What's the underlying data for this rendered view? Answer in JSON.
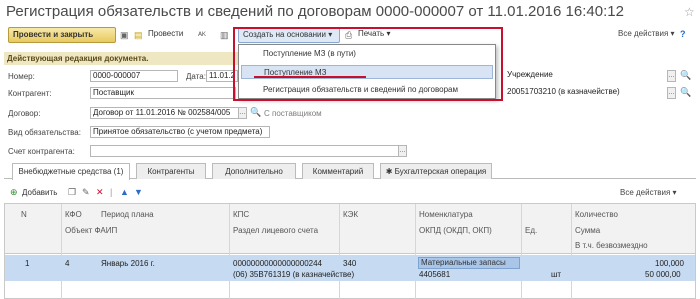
{
  "window": {
    "title": "Регистрация обязательств и сведений по договорам 0000-000007 от 11.01.2016 16:40:12"
  },
  "toolbar": {
    "post_close": "Провести и закрыть",
    "post": "Провести",
    "create_based": "Создать на основании",
    "print": "Печать",
    "all_actions": "Все действия"
  },
  "dropdown": {
    "items": [
      "Поступление МЗ (в пути)",
      "Поступление МЗ",
      "Регистрация обязательств и сведений по договорам"
    ]
  },
  "form": {
    "edit_note": "Действующая редакция документа.",
    "number_label": "Номер:",
    "number": "0000-000007",
    "date_label": "Дата:",
    "date": "11.01.2",
    "institution": "Учреждение",
    "contractor_label": "Контрагент:",
    "contractor": "Поставщик",
    "contractor_account": "20051703210 (в казначействе)",
    "contract_label": "Договор:",
    "contract": "Договор от 11.01.2016 № 002584/005",
    "contract_link": "С поставщиком",
    "obligation_type_label": "Вид обязательства:",
    "obligation_type": "Принятое обязательство (с учетом предмета)",
    "contractor_acc_label": "Счет контрагента:"
  },
  "tabs": [
    "Внебюджетные средства (1)",
    "Контрагенты",
    "Дополнительно",
    "Комментарий",
    "Бухгалтерская операция"
  ],
  "grid_toolbar": {
    "add": "Добавить",
    "all_actions": "Все действия"
  },
  "grid": {
    "headers": {
      "n": "N",
      "kfo": "КФО",
      "period": "Период плана",
      "kps": "КПС",
      "kek": "КЭК",
      "nomenclature": "Номенклатура",
      "quantity": "Количество",
      "object": "Объект ФАИП",
      "section": "Раздел лицевого счета",
      "okpd": "ОКПД (ОКДП, ОКП)",
      "unit": "Ед.",
      "sum": "Сумма",
      "free": "В т.ч. безвозмездно"
    },
    "rows": [
      {
        "n": "1",
        "kfo": "4",
        "period": "Январь 2016 г.",
        "kps": "00000000000000000244",
        "kek": "340",
        "nomenclature": "Материальные запасы",
        "quantity": "100,000",
        "section": "(06) 35В761319 (в казначействе)",
        "okpd": "4405681",
        "unit": "шт",
        "sum": "50 000,00"
      }
    ]
  }
}
